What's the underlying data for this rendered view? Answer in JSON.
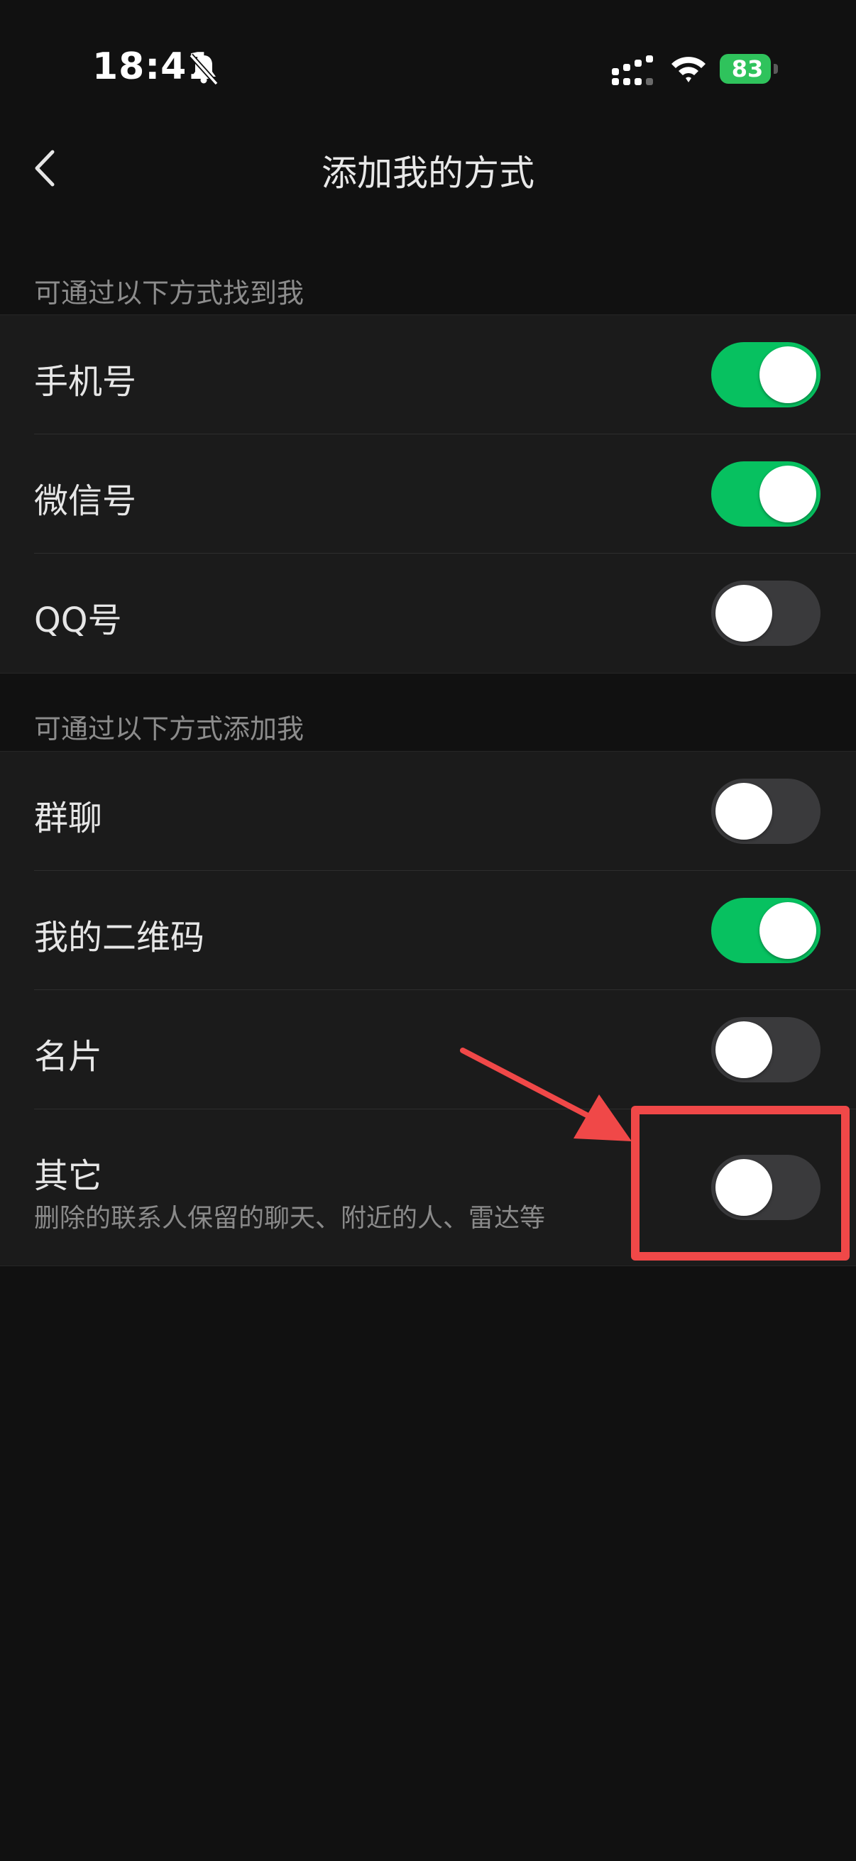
{
  "status_bar": {
    "time": "18:41",
    "battery": "83",
    "icons": [
      "bell-slash-icon",
      "signal-icon",
      "wifi-icon",
      "battery-charging-icon"
    ]
  },
  "nav": {
    "title": "添加我的方式",
    "back_icon": "chevron-left-icon"
  },
  "sections": [
    {
      "header": "可通过以下方式找到我",
      "items": [
        {
          "label": "手机号",
          "enabled": true
        },
        {
          "label": "微信号",
          "enabled": true
        },
        {
          "label": "QQ号",
          "enabled": false
        }
      ]
    },
    {
      "header": "可通过以下方式添加我",
      "items": [
        {
          "label": "群聊",
          "enabled": false
        },
        {
          "label": "我的二维码",
          "enabled": true
        },
        {
          "label": "名片",
          "enabled": false
        },
        {
          "label": "其它",
          "sublabel": "删除的联系人保留的聊天、附近的人、雷达等",
          "enabled": false
        }
      ]
    }
  ],
  "colors": {
    "background": "#111111",
    "cell": "#1b1b1b",
    "toggle_on": "#07c160",
    "toggle_off": "#3a3a3c",
    "annotation": "#f04848"
  }
}
